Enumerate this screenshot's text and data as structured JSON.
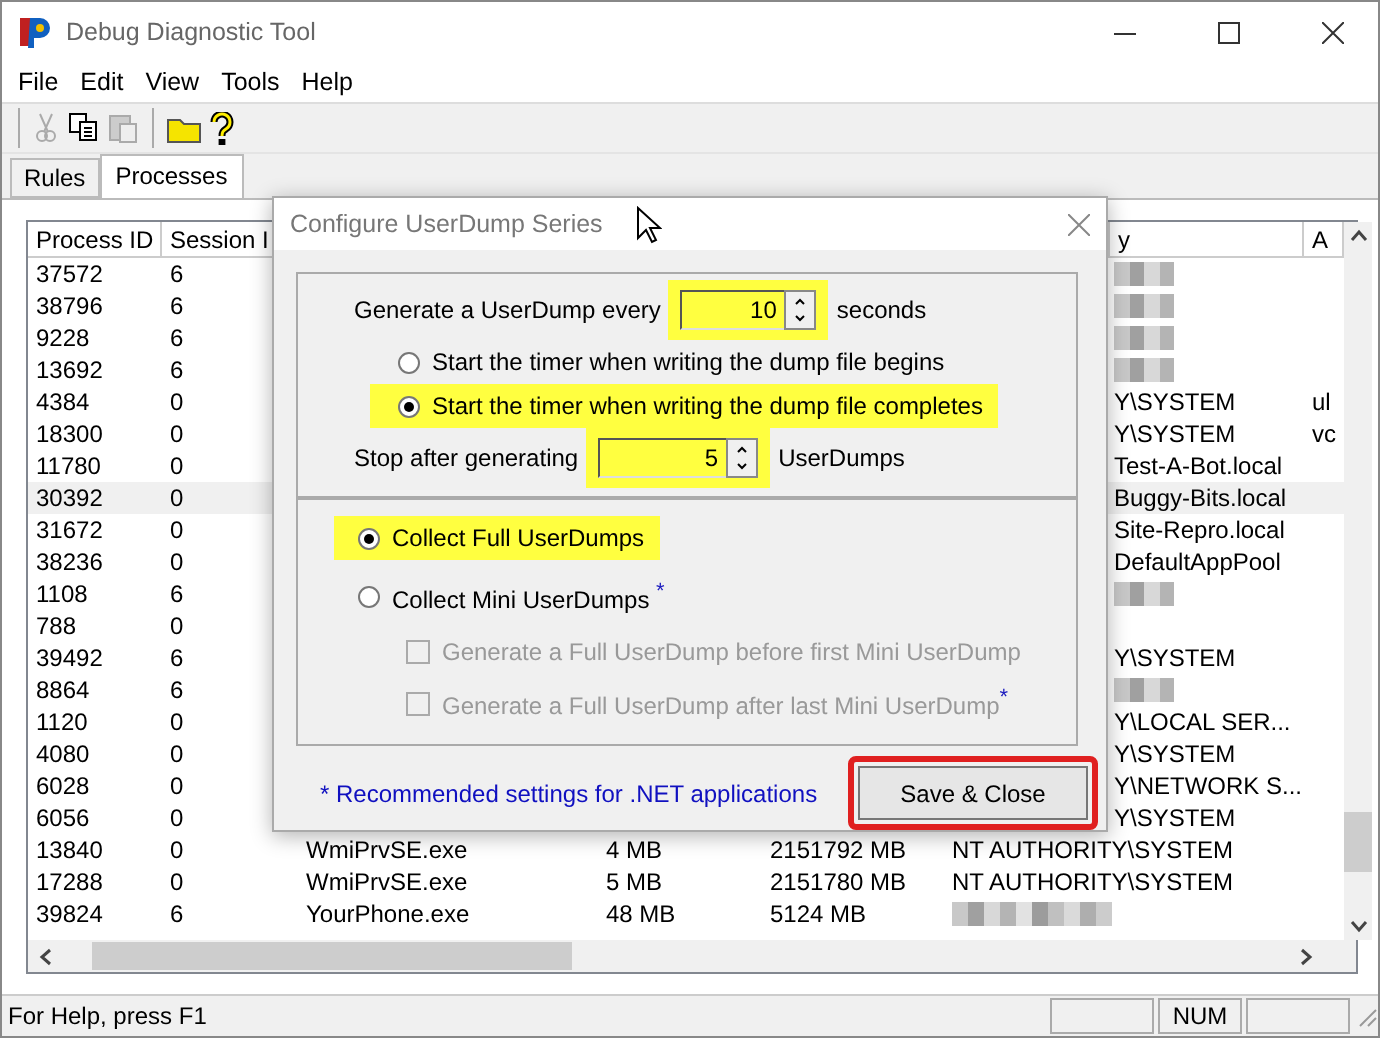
{
  "window": {
    "title": "Debug Diagnostic Tool"
  },
  "menu": [
    "File",
    "Edit",
    "View",
    "Tools",
    "Help"
  ],
  "toolbar": [
    {
      "kind": "cut",
      "disabled": true
    },
    {
      "kind": "copy",
      "disabled": false
    },
    {
      "kind": "paste",
      "disabled": true
    },
    {
      "kind": "separator"
    },
    {
      "kind": "folder",
      "disabled": false
    },
    {
      "kind": "help",
      "disabled": false
    }
  ],
  "tabs": [
    {
      "label": "Rules",
      "selected": false
    },
    {
      "label": "Processes",
      "selected": true
    }
  ],
  "table": {
    "header": {
      "process_id": "Process ID",
      "session_id": "Session I",
      "user": {
        "text": "y",
        "clipped": true
      },
      "column_a": "A"
    },
    "rows": [
      {
        "process_id": "37572",
        "session_id": "6",
        "user": {
          "redacted": true,
          "clipped": true
        },
        "selected": false
      },
      {
        "process_id": "38796",
        "session_id": "6",
        "user": {
          "redacted": true,
          "clipped": true
        },
        "selected": false
      },
      {
        "process_id": "9228",
        "session_id": "6",
        "user": {
          "redacted": true,
          "clipped": true
        },
        "selected": false
      },
      {
        "process_id": "13692",
        "session_id": "6",
        "user": {
          "redacted": true,
          "clipped": true
        },
        "selected": false
      },
      {
        "process_id": "4384",
        "session_id": "0",
        "user": {
          "text": "Y\\SYSTEM",
          "clipped": true
        },
        "column_a": "ul",
        "selected": false
      },
      {
        "process_id": "18300",
        "session_id": "0",
        "user": {
          "text": "Y\\SYSTEM",
          "clipped": true
        },
        "column_a": "vc",
        "selected": false
      },
      {
        "process_id": "11780",
        "session_id": "0",
        "user": {
          "text": "Test-A-Bot.local",
          "clipped": true
        },
        "selected": false
      },
      {
        "process_id": "30392",
        "session_id": "0",
        "user": {
          "text": "Buggy-Bits.local",
          "clipped": true
        },
        "selected": true
      },
      {
        "process_id": "31672",
        "session_id": "0",
        "user": {
          "text": "Site-Repro.local",
          "clipped": true
        },
        "selected": false
      },
      {
        "process_id": "38236",
        "session_id": "0",
        "user": {
          "text": "DefaultAppPool",
          "clipped": true
        },
        "selected": false
      },
      {
        "process_id": "1108",
        "session_id": "6",
        "user": {
          "redacted": true,
          "clipped": true
        },
        "selected": false
      },
      {
        "process_id": "788",
        "session_id": "0",
        "selected": false
      },
      {
        "process_id": "39492",
        "session_id": "6",
        "user": {
          "text": "Y\\SYSTEM",
          "clipped": true
        },
        "selected": false
      },
      {
        "process_id": "8864",
        "session_id": "6",
        "user": {
          "redacted": true,
          "clipped": true
        },
        "selected": false
      },
      {
        "process_id": "1120",
        "session_id": "0",
        "user": {
          "text": "Y\\LOCAL SER...",
          "clipped": true
        },
        "selected": false
      },
      {
        "process_id": "4080",
        "session_id": "0",
        "user": {
          "text": "Y\\SYSTEM",
          "clipped": true
        },
        "selected": false
      },
      {
        "process_id": "6028",
        "session_id": "0",
        "user": {
          "text": "Y\\NETWORK S...",
          "clipped": true
        },
        "selected": false
      },
      {
        "process_id": "6056",
        "session_id": "0",
        "user": {
          "text": "Y\\SYSTEM",
          "clipped": true
        },
        "selected": false
      },
      {
        "process_id": "13840",
        "session_id": "0",
        "name": "WmiPrvSE.exe",
        "private_mem": "4 MB",
        "virtual_mem": "2151792 MB",
        "user": {
          "text": "NT AUTHORITY\\SYSTEM",
          "clipped": false
        },
        "selected": false
      },
      {
        "process_id": "17288",
        "session_id": "0",
        "name": "WmiPrvSE.exe",
        "private_mem": "5 MB",
        "virtual_mem": "2151780 MB",
        "user": {
          "text": "NT AUTHORITY\\SYSTEM",
          "clipped": false
        },
        "selected": false
      },
      {
        "process_id": "39824",
        "session_id": "6",
        "name": "YourPhone.exe",
        "private_mem": "48 MB",
        "virtual_mem": "5124 MB",
        "user": {
          "redacted": true,
          "clipped": false
        },
        "selected": false
      }
    ]
  },
  "dialog": {
    "title": "Configure UserDump Series",
    "interval": {
      "label": "Generate a UserDump every",
      "value": "10",
      "unit": "seconds",
      "highlighted": true
    },
    "timer_options": [
      {
        "label": "Start the timer when writing the dump file begins",
        "selected": false,
        "highlighted": false
      },
      {
        "label": "Start the timer when writing the dump file completes",
        "selected": true,
        "highlighted": true
      }
    ],
    "stop": {
      "label": "Stop after generating",
      "value": "5",
      "unit": "UserDumps",
      "highlighted": true
    },
    "dump_types": [
      {
        "label": "Collect Full UserDumps",
        "selected": true,
        "highlighted": true
      },
      {
        "label": "Collect Mini UserDumps",
        "mark": "*",
        "selected": false,
        "highlighted": false
      }
    ],
    "mini_options": [
      {
        "label": "Generate a Full UserDump before first Mini UserDump",
        "checked": false,
        "disabled": true
      },
      {
        "label": "Generate a Full UserDump after last Mini UserDump",
        "mark": "*",
        "checked": false,
        "disabled": true
      }
    ],
    "note": "* Recommended settings for .NET applications",
    "button": {
      "label": "Save & Close",
      "highlighted": true
    }
  },
  "status_bar": {
    "text": "For Help, press F1",
    "indicator": "NUM"
  }
}
